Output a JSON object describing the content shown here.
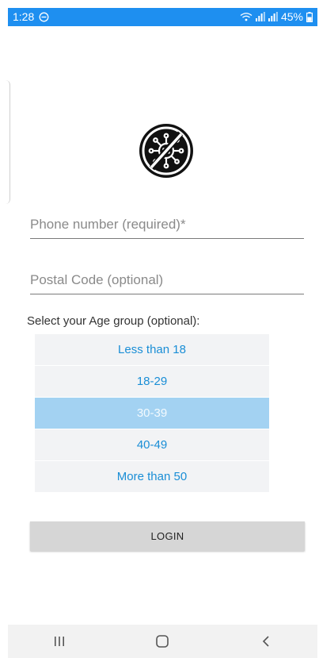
{
  "status_bar": {
    "time": "1:28",
    "battery": "45%",
    "bg_color": "#1e8ff0"
  },
  "logo": {
    "icon": "no-virus-icon"
  },
  "form": {
    "phone_placeholder": "Phone number (required)*",
    "postal_placeholder": "Postal Code (optional)",
    "age_label": "Select your Age group (optional):",
    "age_options": [
      "Less than 18",
      "18-29",
      "30-39",
      "40-49",
      "More than 50"
    ],
    "selected_age": "30-39",
    "login_label": "LOGIN"
  },
  "colors": {
    "accent": "#1a8ed6",
    "selected_bg": "#a3d2f2",
    "option_bg": "#f2f3f5"
  },
  "nav_bar": {
    "buttons": [
      "recent-apps-icon",
      "home-icon",
      "back-icon"
    ]
  }
}
